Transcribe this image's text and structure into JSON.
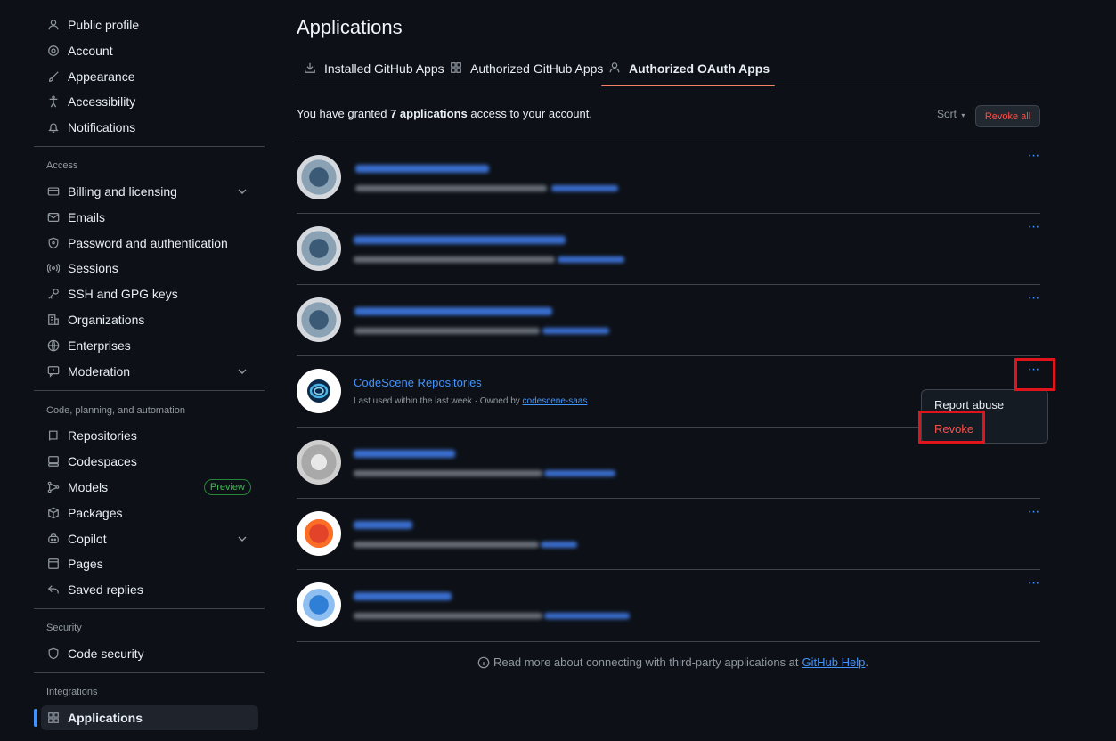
{
  "sidebar": {
    "top_items": [
      {
        "label": "Public profile",
        "icon": "person-icon"
      },
      {
        "label": "Account",
        "icon": "gear-icon"
      },
      {
        "label": "Appearance",
        "icon": "paintbrush-icon"
      },
      {
        "label": "Accessibility",
        "icon": "accessibility-icon"
      },
      {
        "label": "Notifications",
        "icon": "bell-icon"
      }
    ],
    "access_heading": "Access",
    "access_items": [
      {
        "label": "Billing and licensing",
        "icon": "credit-card-icon"
      },
      {
        "label": "Emails",
        "icon": "mail-icon"
      },
      {
        "label": "Password and authentication",
        "icon": "shield-lock-icon"
      },
      {
        "label": "Sessions",
        "icon": "broadcast-icon"
      },
      {
        "label": "SSH and GPG keys",
        "icon": "key-icon"
      },
      {
        "label": "Organizations",
        "icon": "organization-icon"
      },
      {
        "label": "Enterprises",
        "icon": "globe-icon"
      },
      {
        "label": "Moderation",
        "icon": "report-icon"
      }
    ],
    "code_heading": "Code, planning, and automation",
    "code_items": [
      {
        "label": "Repositories",
        "icon": "repo-icon"
      },
      {
        "label": "Codespaces",
        "icon": "codespaces-icon"
      },
      {
        "label": "Models",
        "icon": "models-icon"
      },
      {
        "label": "Packages",
        "icon": "package-icon"
      },
      {
        "label": "Copilot",
        "icon": "copilot-icon"
      },
      {
        "label": "Pages",
        "icon": "browser-icon"
      },
      {
        "label": "Saved replies",
        "icon": "reply-icon"
      }
    ],
    "preview_badge": "Preview",
    "security_heading": "Security",
    "security_items": [
      {
        "label": "Code security",
        "icon": "shield-check-icon"
      }
    ],
    "integrations_heading": "Integrations",
    "integrations_items": [
      {
        "label": "Applications",
        "icon": "apps-icon"
      }
    ]
  },
  "main": {
    "title": "Applications",
    "tabs": [
      {
        "label": "Installed GitHub Apps",
        "icon": "download-icon"
      },
      {
        "label": "Authorized GitHub Apps",
        "icon": "apps-icon"
      },
      {
        "label": "Authorized OAuth Apps",
        "icon": "person-icon"
      }
    ],
    "summary_prefix": "You have granted",
    "summary_count": "7 applications",
    "summary_suffix": "access to your account.",
    "sort_label": "Sort",
    "revoke_all_label": "Revoke all",
    "visible_app": {
      "name": "CodeScene Repositories",
      "meta_prefix": "Last used within the last week · Owned by",
      "owner": "codescene-saas"
    },
    "footer_text": "Read more about connecting with third-party applications at",
    "footer_link": "GitHub Help",
    "footer_period": "."
  },
  "menu": {
    "report_abuse": "Report abuse",
    "revoke": "Revoke"
  },
  "colors": {
    "background": "#0d1117",
    "link": "#4493f8",
    "danger": "#f85149",
    "highlight_box": "#e0141a",
    "tab_underline": "#f78166"
  }
}
